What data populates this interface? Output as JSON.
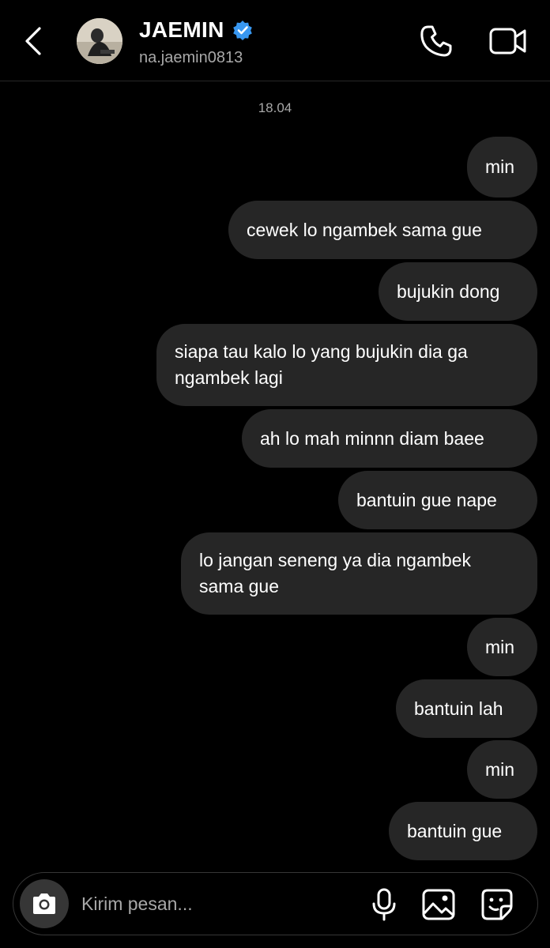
{
  "header": {
    "back_icon": "chevron-left-icon",
    "name": "JAEMIN",
    "verified_icon": "verified-badge-icon",
    "username": "na.jaemin0813",
    "call_icon": "phone-icon",
    "video_icon": "video-camera-icon"
  },
  "thread": {
    "date": "18.04",
    "messages": [
      {
        "text": "min",
        "sender": "me"
      },
      {
        "text": "cewek lo ngambek sama gue",
        "sender": "me"
      },
      {
        "text": "bujukin dong",
        "sender": "me"
      },
      {
        "text": "siapa tau kalo lo yang bujukin dia ga ngambek lagi",
        "sender": "me"
      },
      {
        "text": "ah lo mah minnn diam baee",
        "sender": "me"
      },
      {
        "text": "bantuin gue nape",
        "sender": "me"
      },
      {
        "text": "lo jangan seneng ya dia ngambek sama gue",
        "sender": "me"
      },
      {
        "text": "min",
        "sender": "me"
      },
      {
        "text": "bantuin lah",
        "sender": "me"
      },
      {
        "text": "min",
        "sender": "me"
      },
      {
        "text": "bantuin gue",
        "sender": "me"
      }
    ]
  },
  "composer": {
    "camera_icon": "camera-icon",
    "placeholder": "Kirim pesan...",
    "mic_icon": "microphone-icon",
    "gallery_icon": "image-icon",
    "sticker_icon": "sticker-icon"
  },
  "colors": {
    "background": "#000000",
    "bubble": "#262626",
    "secondary_text": "#a8a8a8",
    "verified": "#3897f0"
  }
}
